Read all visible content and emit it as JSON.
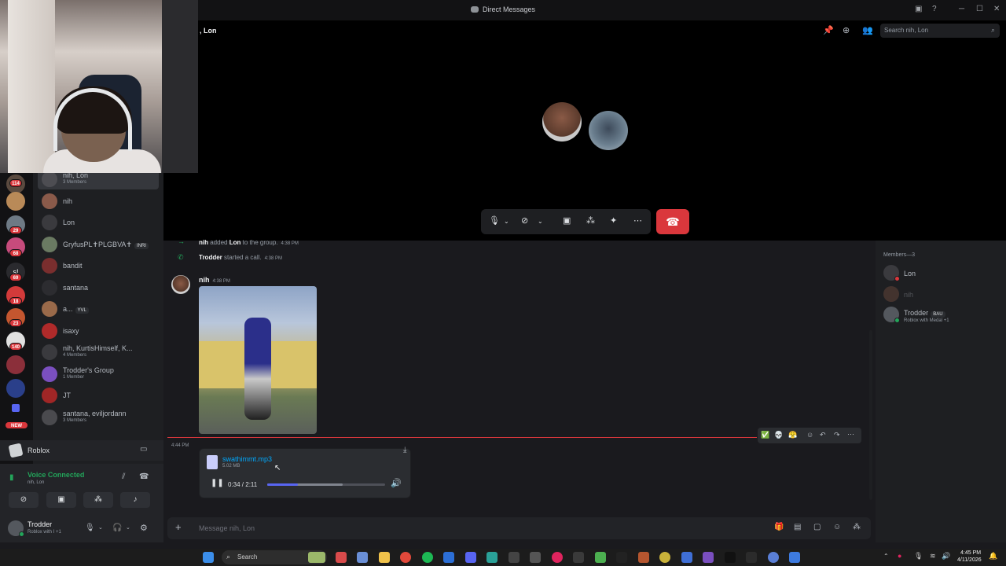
{
  "window": {
    "title": "Direct Messages",
    "controls": [
      "─",
      "☐",
      "✕"
    ]
  },
  "header": {
    "channel_name": ", Lon",
    "search_placeholder": "Search nih, Lon"
  },
  "rail": {
    "badges": [
      "114",
      "29",
      "68",
      "69",
      "18",
      "23",
      "140",
      "NEW"
    ]
  },
  "dm_list": [
    {
      "name": "nih, Lon",
      "sub": "3 Members",
      "selected": true
    },
    {
      "name": "nih"
    },
    {
      "name": "Lon"
    },
    {
      "name": "GryfusPL✝PLGBVA✝",
      "tag": "INRI"
    },
    {
      "name": "bandit"
    },
    {
      "name": "santana"
    },
    {
      "name": "a...",
      "tag": "YVL"
    },
    {
      "name": "isaxy"
    },
    {
      "name": "nih, KurtisHimself, K...",
      "sub": "4 Members"
    },
    {
      "name": "Trodder's Group",
      "sub": "1 Member"
    },
    {
      "name": "JT"
    },
    {
      "name": "santana, eviljordann",
      "sub": "3 Members"
    }
  ],
  "activity": {
    "label": "Roblox"
  },
  "voice": {
    "status": "Voice Connected",
    "channel": "nih, Lon"
  },
  "user": {
    "name": "Trodder",
    "status": "Roblox with I +1"
  },
  "chat": {
    "system1": {
      "actor": "nih",
      "text": "added",
      "target": "Lon",
      "suffix": "to the group.",
      "time": "4:38 PM"
    },
    "system2": {
      "actor": "Trodder",
      "text": "started a call.",
      "time": "4:38 PM"
    },
    "message1": {
      "author": "nih",
      "time": "4:38 PM"
    },
    "message2_time": "4:44 PM",
    "attachment": {
      "filename": "swathimmt.mp3",
      "size": "5.02 MB",
      "time": "0:34 / 2:11",
      "progress": 0.26,
      "buffered": 0.64
    },
    "input_placeholder": "Message nih, Lon",
    "reactions": [
      "✅",
      "💀",
      "😤"
    ]
  },
  "members": {
    "header": "Members—3",
    "list": [
      {
        "name": "Lon"
      },
      {
        "name": "nih",
        "dim": true
      },
      {
        "name": "Trodder",
        "tag": "BAU",
        "status": "Roblox with Medal +1"
      }
    ]
  },
  "taskbar": {
    "search": "Search",
    "time": "4:45 PM",
    "date": "4/11/2026"
  },
  "colors": {
    "accent": "#5865f2",
    "danger": "#da373c",
    "online": "#23a55a"
  }
}
